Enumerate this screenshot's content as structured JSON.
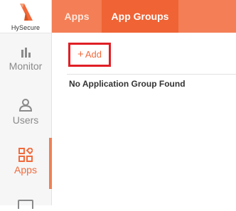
{
  "brand": {
    "name": "HySecure",
    "accent": "#f26a3c"
  },
  "sidebar": {
    "items": [
      {
        "label": "Monitor",
        "icon": "bar-chart-icon",
        "active": false
      },
      {
        "label": "Users",
        "icon": "user-icon",
        "active": false
      },
      {
        "label": "Apps",
        "icon": "apps-grid-icon",
        "active": true
      },
      {
        "label": "",
        "icon": "monitor-icon",
        "active": false
      }
    ]
  },
  "tabs": [
    {
      "label": "Apps",
      "active": false
    },
    {
      "label": "App Groups",
      "active": true
    }
  ],
  "main": {
    "add_label": "Add",
    "empty_message": "No Application Group Found"
  },
  "colors": {
    "topbar": "#f47e55",
    "tab_active": "#ef6334",
    "highlight_border": "#e01f26"
  }
}
